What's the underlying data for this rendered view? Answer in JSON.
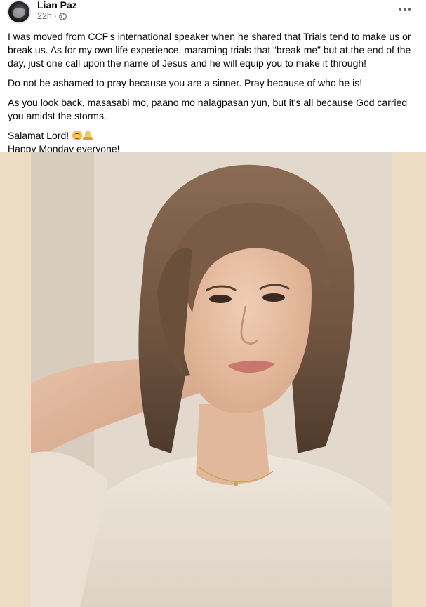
{
  "post": {
    "author": "Lian Paz",
    "time": "22h",
    "separator": "·",
    "icons": {
      "audience": "globe-icon",
      "more": "more-options-icon"
    },
    "paragraphs": [
      "I was moved from CCF's international speaker when he shared that Trials tend to make us or break us. As for my own life experience, maraming trials that “break me” but at the end of the day, just one call upon the name of Jesus and he will equip you to make it through!",
      "Do not be ashamed to pray because you are a sinner. Pray because of who he is!",
      "As you look back, masasabi mo, paano mo nalagpasan yun, but it's all because God carried you amidst the storms."
    ],
    "closing_line_1": "Salamat Lord!",
    "closing_line_1_emojis": [
      "smiling-face-emoji",
      "folded-hands-emoji"
    ],
    "closing_line_2": "Happy Monday everyone!"
  },
  "photo": {
    "subject": "selfie-photo",
    "border_color": "#ecdcc4"
  },
  "colors": {
    "text": "#050505",
    "secondary_text": "#65676b"
  }
}
